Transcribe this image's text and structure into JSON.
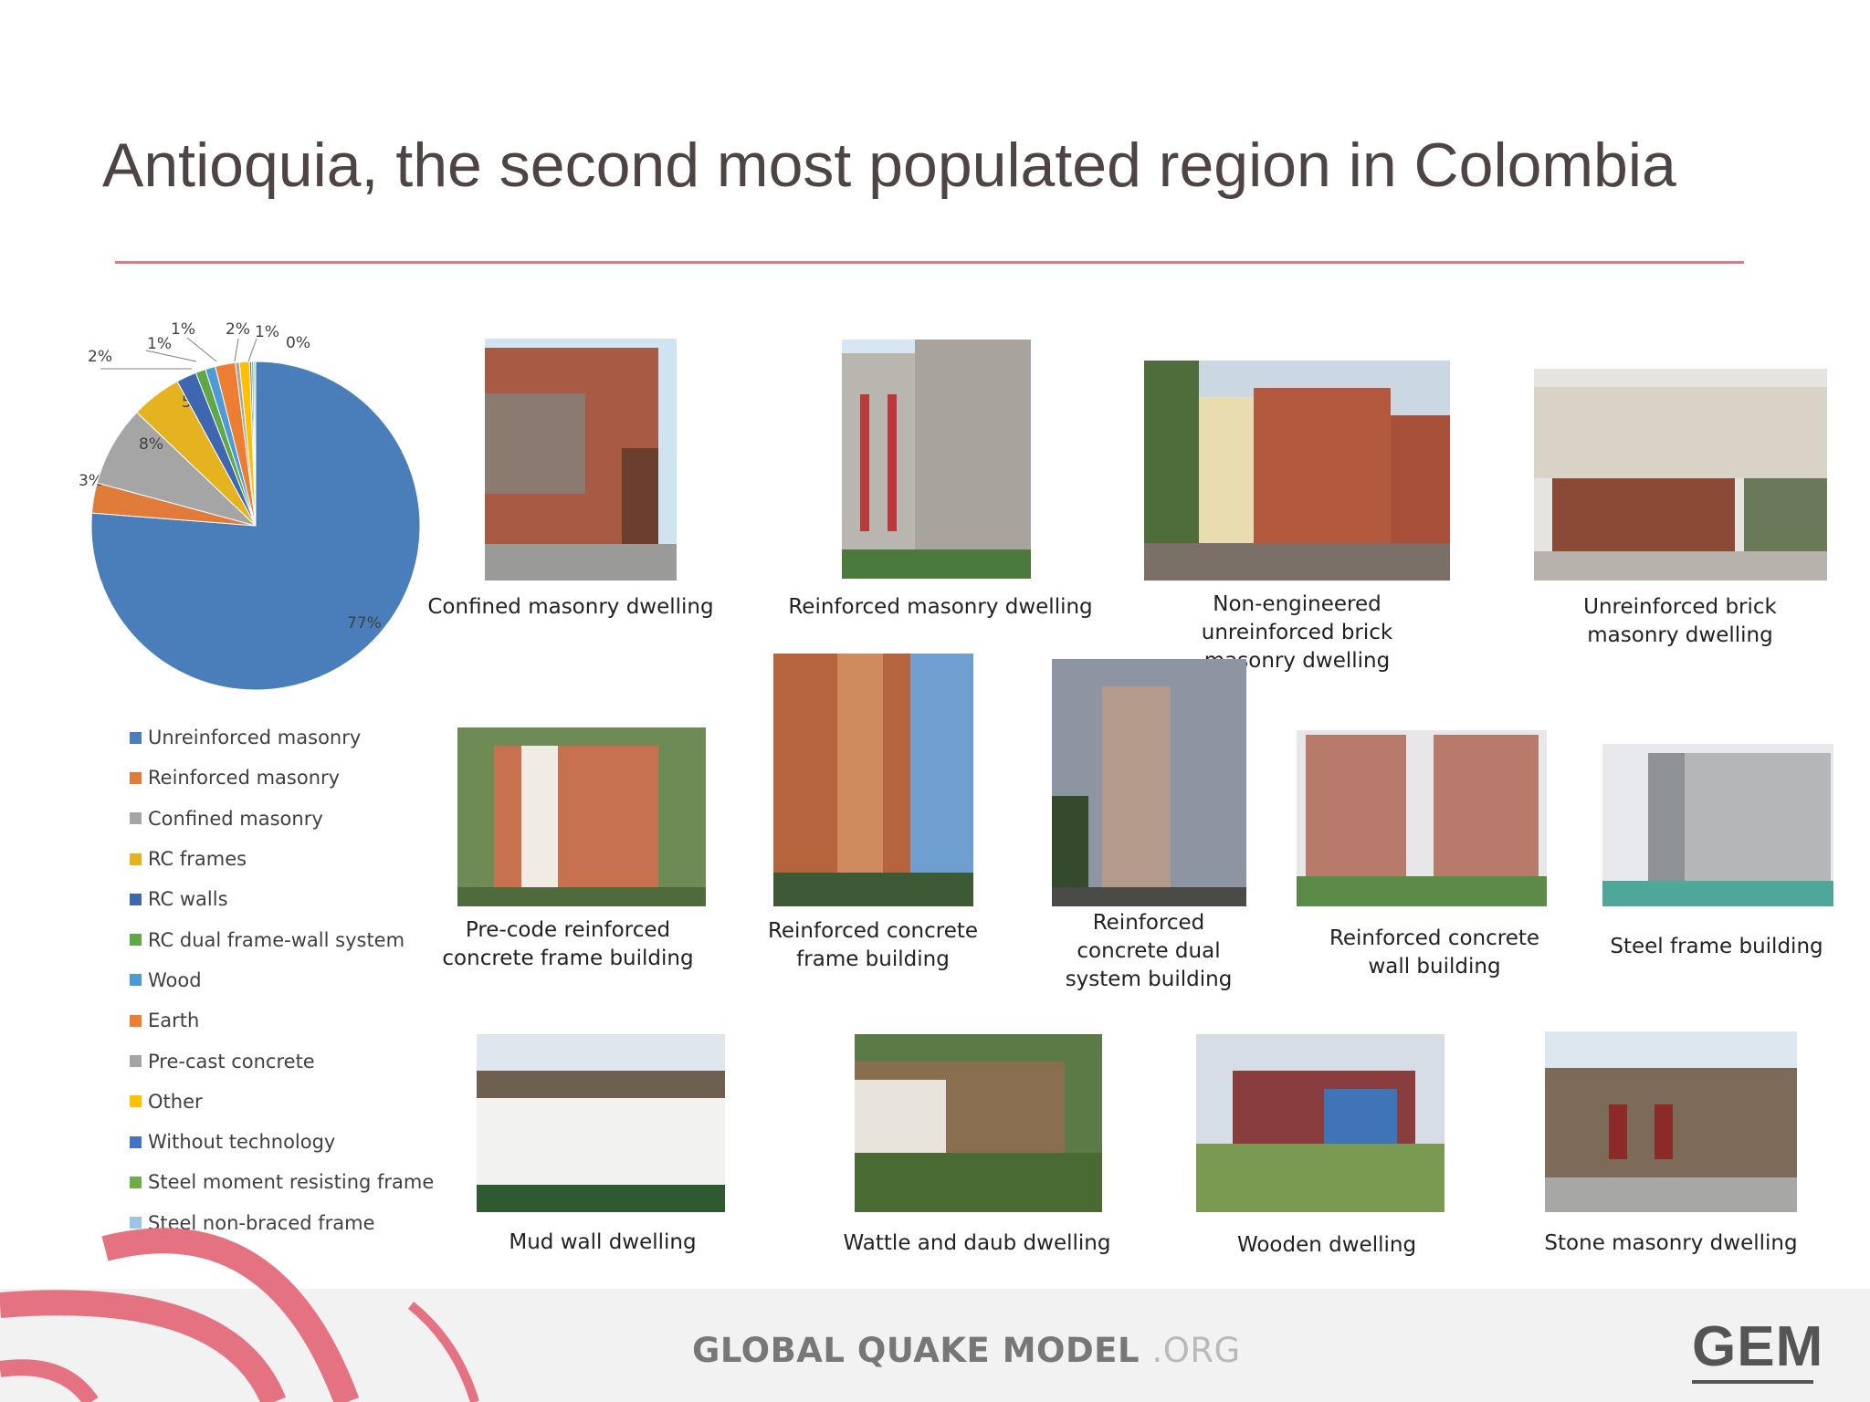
{
  "slide": {
    "title": "Antioquia, the second most populated region in Colombia"
  },
  "chart_data": {
    "type": "pie",
    "slices": [
      {
        "label": "Unreinforced masonry",
        "value": 77,
        "value_label": "77%",
        "color": "#4a7ebb"
      },
      {
        "label": "Reinforced masonry",
        "value": 3,
        "value_label": "3%",
        "color": "#e07b39"
      },
      {
        "label": "Confined masonry",
        "value": 8,
        "value_label": "8%",
        "color": "#a5a5a5"
      },
      {
        "label": "RC frames",
        "value": 5,
        "value_label": "5%",
        "color": "#e5b320"
      },
      {
        "label": "RC walls",
        "value": 2,
        "value_label": "2%",
        "color": "#3f66b0"
      },
      {
        "label": "RC dual frame-wall system",
        "value": 1,
        "value_label": "1%",
        "color": "#5fa845"
      },
      {
        "label": "Wood",
        "value": 1,
        "value_label": "1%",
        "color": "#4c9ad6"
      },
      {
        "label": "Earth",
        "value": 2,
        "value_label": "2%",
        "color": "#ed7d31"
      },
      {
        "label": "Pre-cast concrete",
        "value": 0.4,
        "value_label": "",
        "color": "#a5a5a5"
      },
      {
        "label": "Other",
        "value": 1,
        "value_label": "1%",
        "color": "#ffc000"
      },
      {
        "label": "Without technology",
        "value": 0.2,
        "value_label": "0%",
        "color": "#4472c4"
      },
      {
        "label": "Steel moment resisting frame",
        "value": 0.2,
        "value_label": "",
        "color": "#70ad47"
      },
      {
        "label": "Steel non-braced frame",
        "value": 0.2,
        "value_label": "",
        "color": "#9dc3e6"
      }
    ],
    "legend_position": "bottom"
  },
  "gallery": [
    {
      "name": "confined-masonry",
      "caption": [
        "Confined masonry dwelling"
      ]
    },
    {
      "name": "reinforced-masonry",
      "caption": [
        "Reinforced masonry dwelling"
      ]
    },
    {
      "name": "non-engineered-brick",
      "caption": [
        "Non-engineered unreinforced brick",
        "masonry dwelling"
      ]
    },
    {
      "name": "unreinforced-brick",
      "caption": [
        "Unreinforced brick",
        "masonry dwelling"
      ]
    },
    {
      "name": "precode-rc-frame",
      "caption": [
        "Pre-code reinforced",
        "concrete frame building"
      ]
    },
    {
      "name": "rc-frame",
      "caption": [
        "Reinforced concrete",
        "frame building"
      ]
    },
    {
      "name": "rc-dual",
      "caption": [
        "Reinforced",
        "concrete dual",
        "system building"
      ]
    },
    {
      "name": "rc-wall",
      "caption": [
        "Reinforced concrete",
        "wall building"
      ]
    },
    {
      "name": "steel-frame",
      "caption": [
        "Steel frame building"
      ]
    },
    {
      "name": "mud-wall",
      "caption": [
        "Mud wall dwelling"
      ]
    },
    {
      "name": "wattle-daub",
      "caption": [
        "Wattle and daub dwelling"
      ]
    },
    {
      "name": "wooden",
      "caption": [
        "Wooden dwelling"
      ]
    },
    {
      "name": "stone-masonry",
      "caption": [
        "Stone masonry dwelling"
      ]
    }
  ],
  "footer": {
    "brand": "GLOBAL QUAKE MODEL",
    "brand_suffix": ".ORG",
    "logo": "GEM"
  }
}
